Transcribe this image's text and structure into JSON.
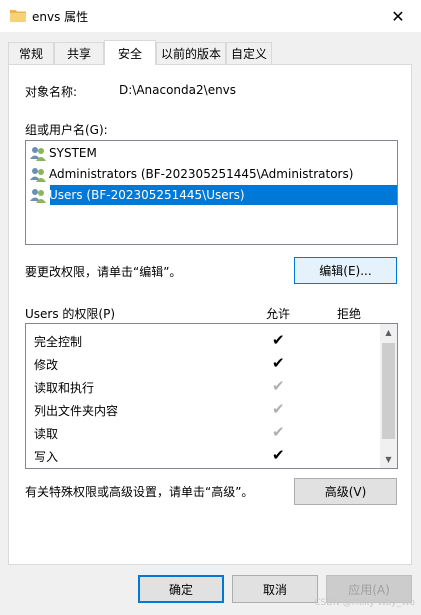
{
  "window": {
    "title": "envs 属性",
    "close_icon": "close-icon"
  },
  "tabs": [
    "常规",
    "共享",
    "安全",
    "以前的版本",
    "自定义"
  ],
  "active_tab": "安全",
  "security": {
    "object_label": "对象名称:",
    "object_value": "D:\\Anaconda2\\envs",
    "group_label": "组或用户名(G):",
    "users": [
      {
        "name": "SYSTEM",
        "icon": "user-group-icon"
      },
      {
        "name": "Administrators (BF-202305251445\\Administrators)",
        "icon": "user-group-icon"
      },
      {
        "name": "Users (BF-202305251445\\Users)",
        "icon": "user-group-icon",
        "selected": true
      }
    ],
    "edit_hint": "要更改权限，请单击“编辑”。",
    "edit_button": "编辑(E)...",
    "perm_title": "Users 的权限(P)",
    "allow_header": "允许",
    "deny_header": "拒绝",
    "permissions": [
      {
        "name": "完全控制",
        "allow": "on"
      },
      {
        "name": "修改",
        "allow": "on"
      },
      {
        "name": "读取和执行",
        "allow": "dim"
      },
      {
        "name": "列出文件夹内容",
        "allow": "dim"
      },
      {
        "name": "读取",
        "allow": "dim"
      },
      {
        "name": "写入",
        "allow": "on"
      }
    ],
    "advanced_hint": "有关特殊权限或高级设置，请单击“高级”。",
    "advanced_button": "高级(V)"
  },
  "footer": {
    "ok": "确定",
    "cancel": "取消",
    "apply": "应用(A)"
  },
  "watermark": "CSDN @Milky Way_Wo",
  "colors": {
    "selection": "#0078d7",
    "folder": "#e8b94a"
  }
}
